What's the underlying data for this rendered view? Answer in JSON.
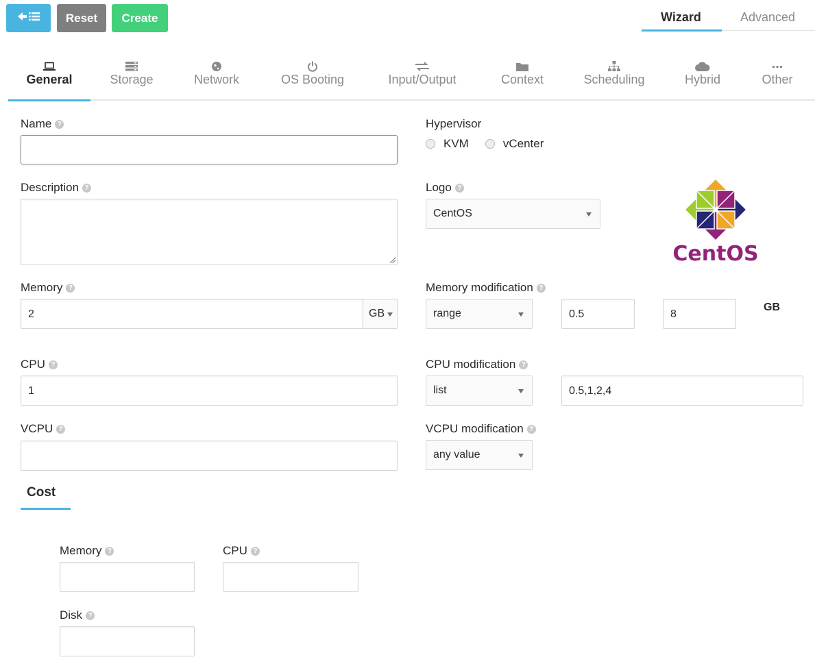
{
  "toolbar": {
    "back_icon": "arrow-left-list-icon",
    "reset_label": "Reset",
    "create_label": "Create",
    "colors": {
      "back": "#4ab4e0",
      "reset": "#7f7f7f",
      "create": "#43d07b"
    }
  },
  "modes": {
    "wizard": "Wizard",
    "advanced": "Advanced",
    "active": "Wizard"
  },
  "tabs": [
    {
      "label": "General",
      "icon": "laptop-icon",
      "active": true
    },
    {
      "label": "Storage",
      "icon": "storage-icon",
      "active": false
    },
    {
      "label": "Network",
      "icon": "globe-icon",
      "active": false
    },
    {
      "label": "OS Booting",
      "icon": "power-icon",
      "active": false
    },
    {
      "label": "Input/Output",
      "icon": "exchange-icon",
      "active": false
    },
    {
      "label": "Context",
      "icon": "folder-icon",
      "active": false
    },
    {
      "label": "Scheduling",
      "icon": "sitemap-icon",
      "active": false
    },
    {
      "label": "Hybrid",
      "icon": "cloud-icon",
      "active": false
    },
    {
      "label": "Other",
      "icon": "ellipsis-icon",
      "active": false
    }
  ],
  "form": {
    "name": {
      "label": "Name",
      "value": ""
    },
    "description": {
      "label": "Description",
      "value": ""
    },
    "memory": {
      "label": "Memory",
      "value": "2",
      "unit": "GB"
    },
    "cpu": {
      "label": "CPU",
      "value": "1"
    },
    "vcpu": {
      "label": "VCPU",
      "value": ""
    },
    "hypervisor": {
      "label": "Hypervisor",
      "options": [
        "KVM",
        "vCenter"
      ],
      "selected": null
    },
    "logo": {
      "label": "Logo",
      "selected": "CentOS",
      "image_text": "CentOS"
    },
    "memory_modification": {
      "label": "Memory modification",
      "type": "range",
      "min": "0.5",
      "max": "8",
      "unit": "GB"
    },
    "cpu_modification": {
      "label": "CPU modification",
      "type": "list",
      "values": "0.5,1,2,4"
    },
    "vcpu_modification": {
      "label": "VCPU modification",
      "type": "any value"
    }
  },
  "cost": {
    "title": "Cost",
    "memory": {
      "label": "Memory",
      "value": ""
    },
    "cpu": {
      "label": "CPU",
      "value": ""
    },
    "disk": {
      "label": "Disk",
      "value": ""
    }
  }
}
